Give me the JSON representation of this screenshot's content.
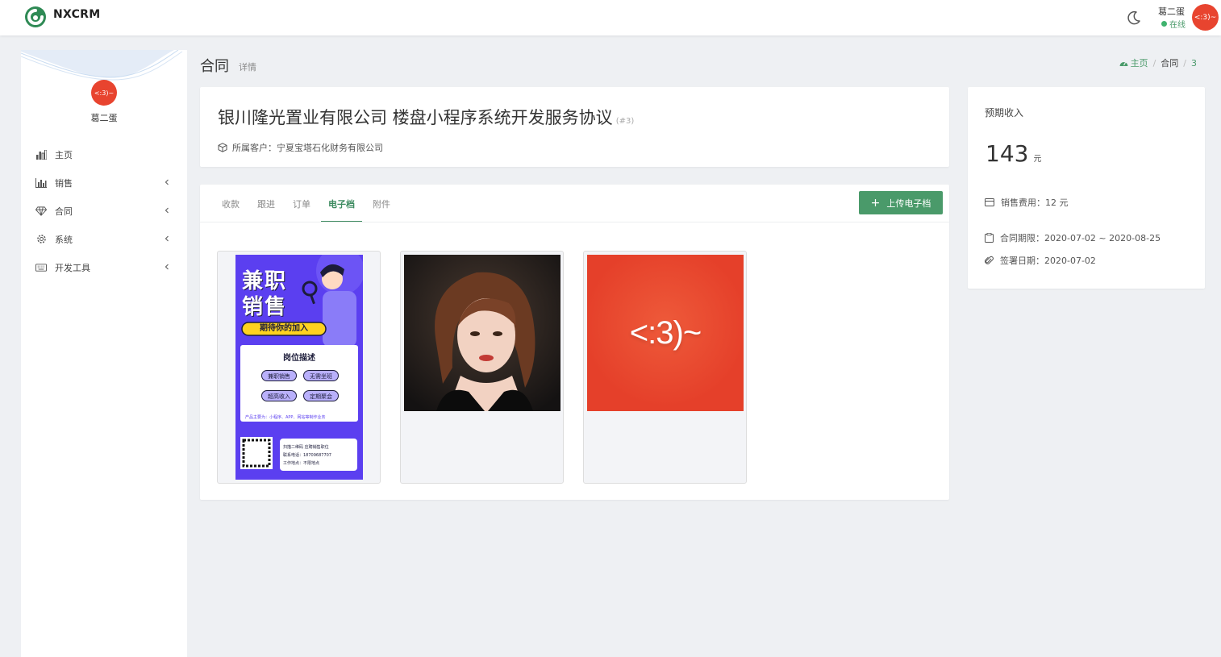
{
  "app": {
    "brand": "NXCRM"
  },
  "user": {
    "name": "葛二蛋",
    "status": "在线",
    "avatar_text": "<:3)~"
  },
  "sidebar": {
    "user_name": "葛二蛋",
    "avatar_text": "<:3)~",
    "items": [
      {
        "label": "主页",
        "icon": "bar-chart-icon"
      },
      {
        "label": "销售",
        "icon": "column-chart-icon"
      },
      {
        "label": "合同",
        "icon": "diamond-icon"
      },
      {
        "label": "系统",
        "icon": "gear-icon"
      },
      {
        "label": "开发工具",
        "icon": "keyboard-icon"
      }
    ]
  },
  "header": {
    "title": "合同",
    "subtitle": "详情"
  },
  "breadcrumb": {
    "home": "主页",
    "section": "合同",
    "current": "3"
  },
  "contract": {
    "title": "银川隆光置业有限公司 楼盘小程序系统开发服务协议",
    "id_label": "(#3)",
    "client_label": "所属客户：",
    "client": "宁夏宝塔石化财务有限公司"
  },
  "tabs": [
    {
      "label": "收款",
      "active": false
    },
    {
      "label": "跟进",
      "active": false
    },
    {
      "label": "订单",
      "active": false
    },
    {
      "label": "电子档",
      "active": true
    },
    {
      "label": "附件",
      "active": false
    }
  ],
  "upload_button": {
    "label": "上传电子档",
    "icon": "plus-icon"
  },
  "poster": {
    "title_line1": "兼职",
    "title_line2": "销售",
    "banner": "期待你的加入",
    "section": "岗位描述",
    "pills": [
      "兼职销售",
      "无需坐班",
      "超高收入",
      "定期聚会"
    ],
    "note": "产品主要为：小程序、APP、网站等制作业务",
    "contact_lines": [
      "扫描二维码 应聘销售职位",
      "联系电话：18709687707",
      "工作地点：不限地点"
    ]
  },
  "third_image_text": "<:3)~",
  "colors": {
    "accent": "#4a9a6a",
    "avatar": "#e8442f",
    "poster_bg": "#5b3ff0"
  },
  "info": {
    "expected_label": "预期收入",
    "expected_value": "143",
    "expected_unit": "元",
    "sales_cost_label": "销售费用：",
    "sales_cost": "12 元",
    "period_label": "合同期限：",
    "period": "2020-07-02 ~ 2020-08-25",
    "sign_label": "签署日期：",
    "sign_date": "2020-07-02"
  }
}
